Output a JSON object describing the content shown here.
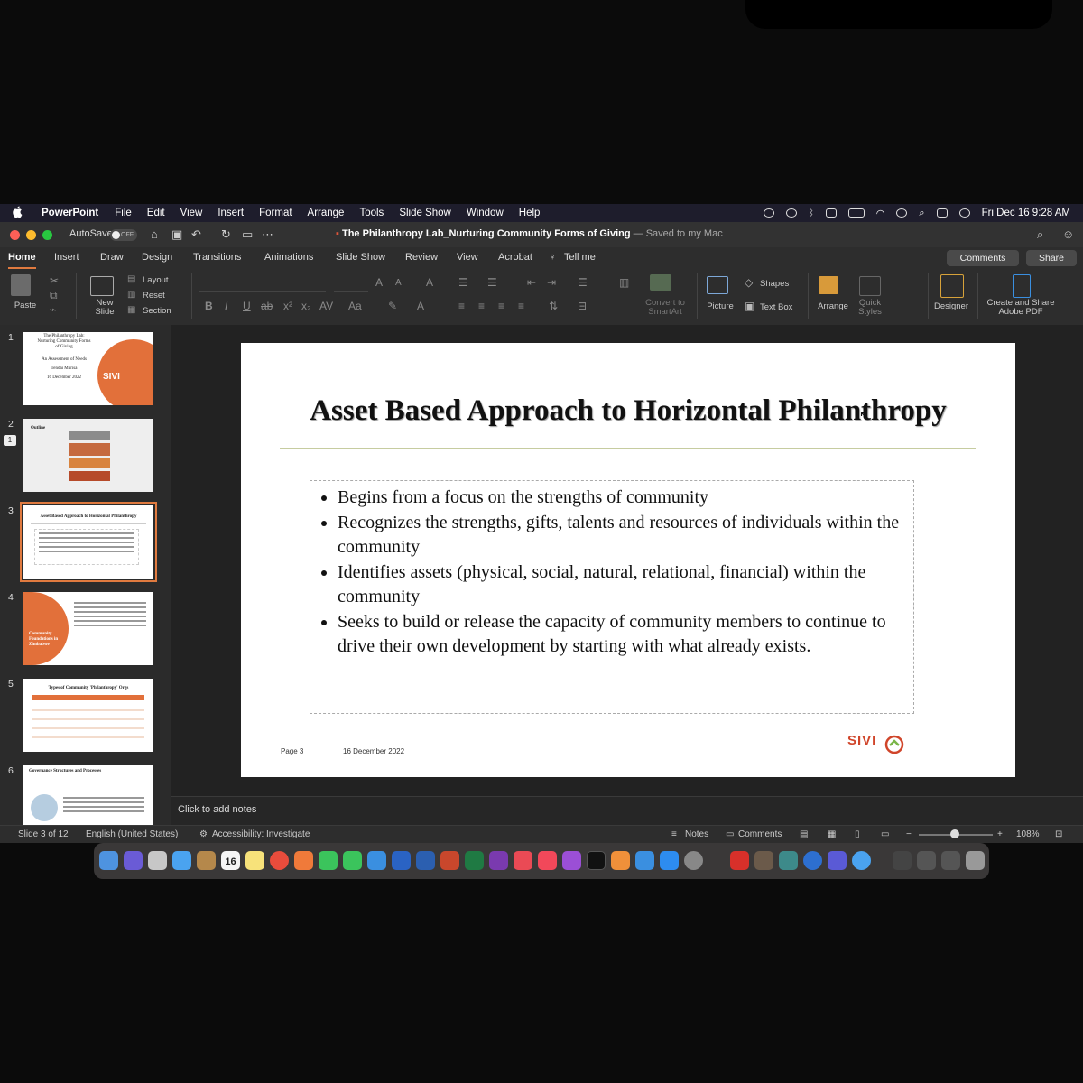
{
  "menubar": {
    "app_name": "PowerPoint",
    "items": [
      "File",
      "Edit",
      "View",
      "Insert",
      "Format",
      "Arrange",
      "Tools",
      "Slide Show",
      "Window",
      "Help"
    ],
    "clock": "Fri Dec 16  9:28 AM"
  },
  "titlebar": {
    "autosave_label": "AutoSave",
    "autosave_state": "OFF",
    "doc_name": "The Philanthropy Lab_Nurturing Community Forms of Giving",
    "saved_status": "— Saved to my Mac"
  },
  "ribbon_tabs": [
    "Home",
    "Insert",
    "Draw",
    "Design",
    "Transitions",
    "Animations",
    "Slide Show",
    "Review",
    "View",
    "Acrobat",
    "Tell me"
  ],
  "buttons": {
    "comments": "Comments",
    "share": "Share"
  },
  "ribbon": {
    "paste": "Paste",
    "new_slide": "New\nSlide",
    "layout": "Layout",
    "reset": "Reset",
    "section": "Section",
    "convert_smartart": "Convert to\nSmartArt",
    "picture": "Picture",
    "shapes": "Shapes",
    "text_box": "Text Box",
    "arrange": "Arrange",
    "quick_styles": "Quick\nStyles",
    "designer": "Designer",
    "create_share_pdf": "Create and Share\nAdobe PDF"
  },
  "thumbnails": [
    {
      "num": "1",
      "lines": [
        "The Philanthropy Lab:",
        "Nurturing Community Forms",
        "of Giving",
        "An Assessment of Needs",
        "Tendai Murisa",
        "16 December 2022"
      ],
      "logo": "SIVI"
    },
    {
      "num": "2",
      "lines": [
        "Outline"
      ],
      "comment_count": "1"
    },
    {
      "num": "3",
      "lines": [
        "Asset Based Approach to Horizontal Philanthropy"
      ]
    },
    {
      "num": "4",
      "lines": [
        "Community",
        "Foundations in",
        "Zimbabwe"
      ]
    },
    {
      "num": "5",
      "lines": [
        "Types of Community 'Philanthropy' Orgs"
      ]
    },
    {
      "num": "6",
      "lines": [
        "Governance Structures and Processes"
      ]
    }
  ],
  "slide": {
    "title": "Asset Based Approach to Horizontal Philanthropy",
    "bullets": [
      "Begins from a focus on the strengths of community",
      "Recognizes the strengths, gifts, talents and resources of individuals within the community",
      "Identifies assets (physical, social, natural, relational, financial) within the community",
      "Seeks to build or release the capacity of community members to continue to drive their own development by starting with what already exists."
    ],
    "page_label": "Page 3",
    "date": "16 December 2022",
    "logo": "SIVI"
  },
  "notes_placeholder": "Click to add notes",
  "status": {
    "slide_position": "Slide 3 of 12",
    "language": "English (United States)",
    "accessibility": "Accessibility: Investigate",
    "notes": "Notes",
    "comments": "Comments",
    "zoom": "108%"
  },
  "dock": {
    "calendar_date": "16"
  },
  "colors": {
    "accent": "#e07a3f",
    "logo_red": "#d0452a",
    "logo_green": "#7ab648"
  }
}
